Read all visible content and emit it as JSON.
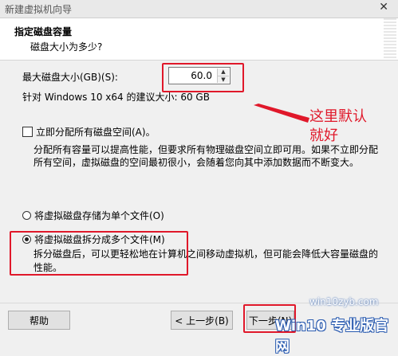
{
  "window": {
    "title": "新建虚拟机向导",
    "close_symbol": "✕"
  },
  "header": {
    "title": "指定磁盘容量",
    "subtitle": "磁盘大小为多少?"
  },
  "disk": {
    "size_label": "最大磁盘大小(GB)(S):",
    "size_value": "60.0",
    "recommend": "针对 Windows 10 x64 的建议大小: 60 GB"
  },
  "allocate": {
    "label": "立即分配所有磁盘空间(A)。",
    "checked": false,
    "description": "分配所有容量可以提高性能，但要求所有物理磁盘空间立即可用。如果不立即分配所有空间，虚拟磁盘的空间最初很小，会随着您向其中添加数据而不断变大。"
  },
  "storage_options": [
    {
      "label": "将虚拟磁盘存储为单个文件(O)",
      "checked": false
    },
    {
      "label": "将虚拟磁盘拆分成多个文件(M)",
      "checked": true,
      "description": "拆分磁盘后，可以更轻松地在计算机之间移动虚拟机，但可能会降低大容量磁盘的性能。"
    }
  ],
  "annotation": {
    "text": "这里默认就好",
    "color": "#e0182a"
  },
  "footer": {
    "help_label": "帮助",
    "back_label": "< 上一步(B)",
    "next_label": "下一步(N)"
  },
  "watermark": {
    "url": "win10zyb.com",
    "brand": "Win10 专业版官网"
  }
}
